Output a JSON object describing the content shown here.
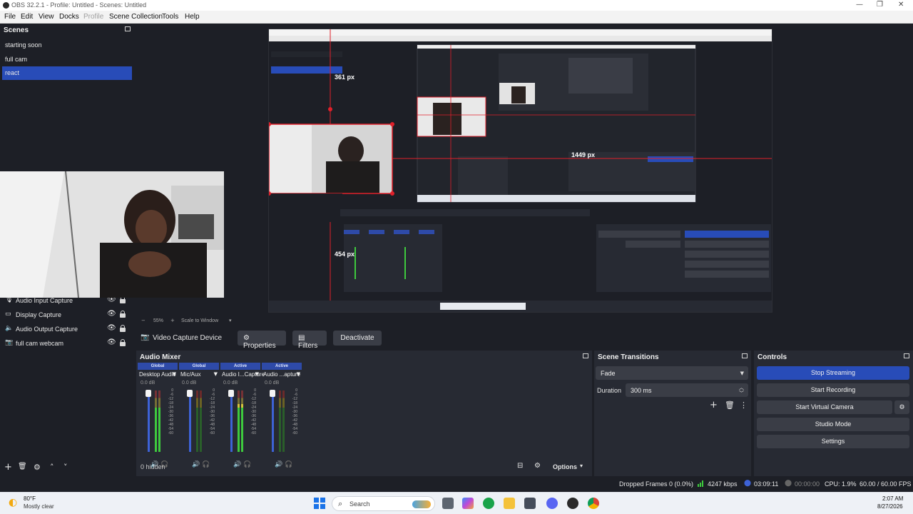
{
  "window": {
    "title": "OBS 32.2.1 - Profile: Untitled - Scenes: Untitled"
  },
  "menu": {
    "file": "File",
    "edit": "Edit",
    "view": "View",
    "docks": "Docks",
    "profile": "Profile",
    "scene_collection": "Scene Collection",
    "tools": "Tools",
    "help": "Help"
  },
  "scenes": {
    "header": "Scenes",
    "items": [
      "starting soon",
      "full cam",
      "react"
    ],
    "selected": "react"
  },
  "sources": {
    "items": [
      "Audio Input Capture",
      "Display Capture",
      "Audio Output Capture",
      "full cam webcam"
    ]
  },
  "preview": {
    "zoom": "55%",
    "scale_mode": "Scale to Window",
    "measure_top": "361 px",
    "measure_right": "1449 px",
    "measure_bottom": "454 px"
  },
  "context_bar": {
    "source_name": "Video Capture Device",
    "properties": "Properties",
    "filters": "Filters",
    "deactivate": "Deactivate"
  },
  "audio_mixer": {
    "header": "Audio Mixer",
    "channels": [
      {
        "status": "Global",
        "name": "Desktop Audio",
        "db": "0.0 dB",
        "level": 0.72
      },
      {
        "status": "Global",
        "name": "Mic/Aux",
        "db": "0.0 dB",
        "level": 0.0
      },
      {
        "status": "Active",
        "name": "Audio I...Capture",
        "db": "0.0 dB",
        "level": 0.78
      },
      {
        "status": "Active",
        "name": "Audio ...apture",
        "db": "0.0 dB",
        "level": 0.0
      }
    ],
    "scale": [
      "0",
      "-6",
      "-12",
      "-18",
      "-24",
      "-30",
      "-36",
      "-42",
      "-48",
      "-54",
      "-60"
    ],
    "hidden_label": "0 hidden",
    "options_label": "Options"
  },
  "scene_transitions": {
    "header": "Scene Transitions",
    "transition": "Fade",
    "duration_label": "Duration",
    "duration_value": "300 ms"
  },
  "controls": {
    "header": "Controls",
    "stop_streaming": "Stop Streaming",
    "start_recording": "Start Recording",
    "start_virtual_camera": "Start Virtual Camera",
    "studio_mode": "Studio Mode",
    "settings": "Settings"
  },
  "status": {
    "dropped_frames": "Dropped Frames 0 (0.0%)",
    "bitrate": "4247 kbps",
    "stream_time": "03:09:11",
    "record_time": "00:00:00",
    "cpu": "CPU: 1.9%",
    "fps": "60.00 / 60.00 FPS"
  },
  "taskbar": {
    "weather_temp": "80°F",
    "weather_desc": "Mostly clear",
    "search_placeholder": "Search",
    "time": "2:07 AM",
    "date": "8/27/2026"
  },
  "colors": {
    "accent": "#284cb8",
    "background": "#1d1f26",
    "dock": "#272a33",
    "button": "#3a3d46",
    "guide_red": "#e0202a"
  }
}
